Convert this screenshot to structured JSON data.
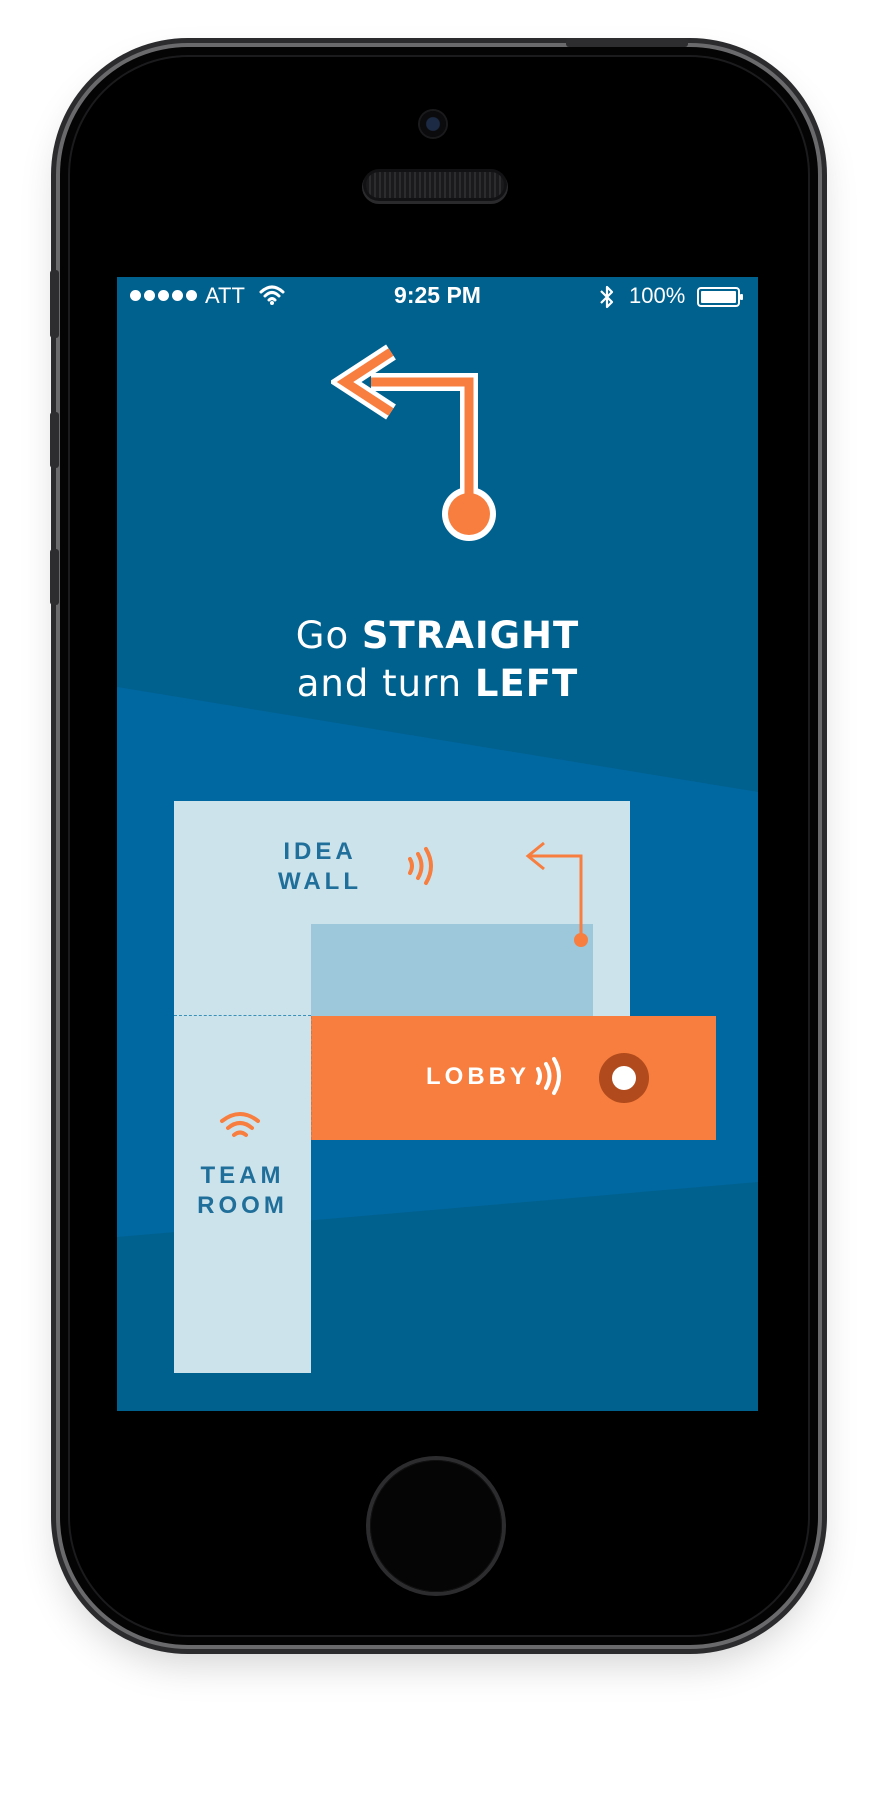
{
  "colors": {
    "screen_bg": "#00618f",
    "accent_orange": "#f77e3e",
    "map_room": "#cde3ec",
    "map_block": "#9dc7da",
    "label_blue": "#1f6f9a",
    "marker_dark": "#b14a1c"
  },
  "status_bar": {
    "carrier": "ATT",
    "time": "9:25 PM",
    "battery": "100%",
    "icons": [
      "signal-dots-icon",
      "wifi-icon",
      "bluetooth-icon",
      "battery-icon"
    ]
  },
  "direction": {
    "line1_pre": "Go ",
    "line1_bold": "STRAIGHT",
    "line2_pre": "and turn ",
    "line2_bold": "LEFT",
    "icon": "turn-left-arrow-icon"
  },
  "map": {
    "idea_wall": {
      "line1": "IDEA",
      "line2": "WALL",
      "icon": "beacon-signal-icon"
    },
    "lobby": {
      "label": "LOBBY",
      "icon": "beacon-signal-icon",
      "marker": "current-location-icon"
    },
    "team_room": {
      "line1": "TEAM",
      "line2": "ROOM",
      "icon": "wifi-beacon-icon"
    },
    "route_icon": "route-turn-left-icon"
  }
}
